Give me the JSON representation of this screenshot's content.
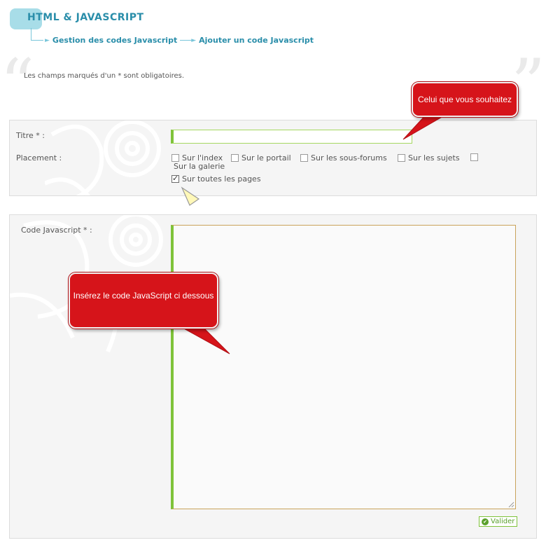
{
  "header": {
    "title": "HTML & JAVASCRIPT",
    "breadcrumb": [
      "Gestion des codes Javascript",
      "Ajouter un code Javascript"
    ]
  },
  "required_note": "Les champs marqués d'un * sont obligatoires.",
  "form": {
    "title_label": "Titre * :",
    "title_value": "",
    "placement_label": "Placement :",
    "placement_options": [
      {
        "label": "Sur l'index",
        "checked": false
      },
      {
        "label": "Sur le portail",
        "checked": false
      },
      {
        "label": "Sur les sous-forums",
        "checked": false
      },
      {
        "label": "Sur les sujets",
        "checked": false
      },
      {
        "label": "Sur la galerie",
        "checked": false
      },
      {
        "label": "Sur toutes les pages",
        "checked": true
      }
    ],
    "code_label": "Code Javascript * :",
    "code_value": "",
    "submit_label": "Valider"
  },
  "callouts": {
    "title_hint": "Celui que vous souhaitez",
    "code_hint": "Insérez le code JavaScript ci dessous"
  },
  "colors": {
    "accent": "#2a8eaa",
    "input_border": "#7fc33a",
    "callout": "#d6141a"
  }
}
